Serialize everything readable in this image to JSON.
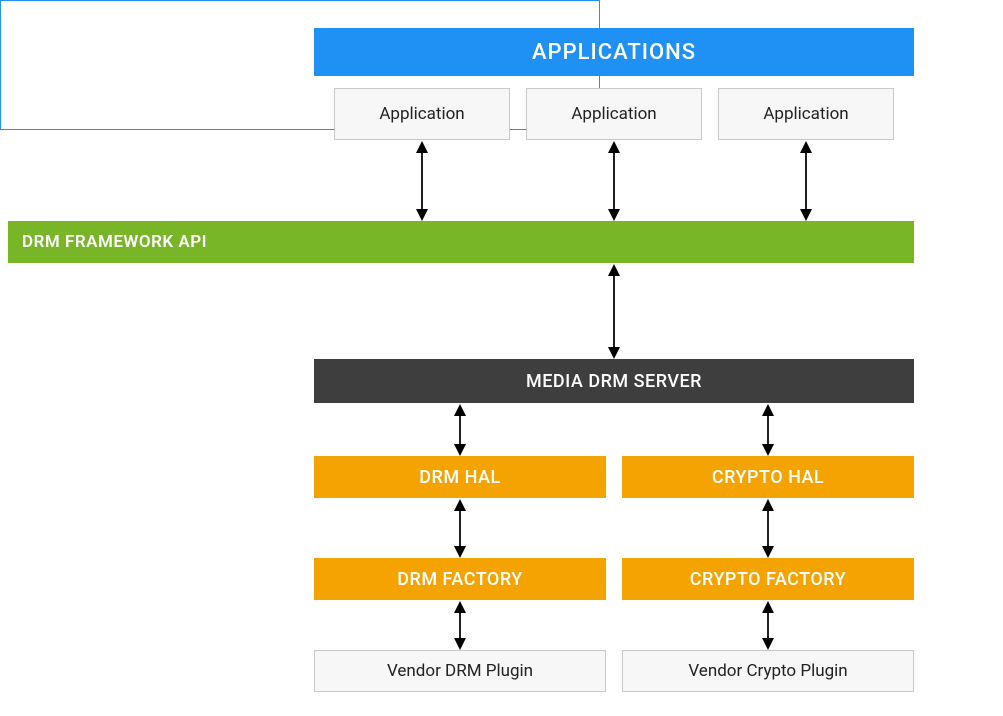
{
  "applications": {
    "header": "APPLICATIONS",
    "items": [
      "Application",
      "Application",
      "Application"
    ]
  },
  "drmFrameworkApi": "DRM FRAMEWORK API",
  "mediaDrmServer": "MEDIA DRM SERVER",
  "hal": {
    "drm": "DRM HAL",
    "crypto": "CRYPTO HAL"
  },
  "factory": {
    "drm": "DRM FACTORY",
    "crypto": "CRYPTO FACTORY"
  },
  "vendor": {
    "drm": "Vendor DRM Plugin",
    "crypto": "Vendor Crypto Plugin"
  },
  "colors": {
    "blue": "#2091f4",
    "green": "#78b527",
    "orange": "#f5a300",
    "darkgrey": "#3e3e3e",
    "lightgrey": "#f7f7f7"
  }
}
